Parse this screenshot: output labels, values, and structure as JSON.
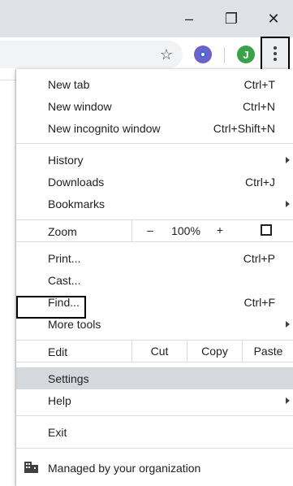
{
  "window": {
    "minimize_glyph": "–",
    "restore_glyph": "❐",
    "close_glyph": "✕"
  },
  "toolbar": {
    "star_glyph": "☆",
    "avatar_letter": "J",
    "accent_color": "#6a62c8",
    "avatar_color": "#3aa34a"
  },
  "menu": {
    "new_tab": {
      "label": "New tab",
      "shortcut": "Ctrl+T"
    },
    "new_window": {
      "label": "New window",
      "shortcut": "Ctrl+N"
    },
    "new_incognito": {
      "label": "New incognito window",
      "shortcut": "Ctrl+Shift+N"
    },
    "history": {
      "label": "History"
    },
    "downloads": {
      "label": "Downloads",
      "shortcut": "Ctrl+J"
    },
    "bookmarks": {
      "label": "Bookmarks"
    },
    "zoom": {
      "label": "Zoom",
      "minus": "–",
      "value": "100%",
      "plus": "+"
    },
    "print": {
      "label": "Print...",
      "shortcut": "Ctrl+P"
    },
    "cast": {
      "label": "Cast..."
    },
    "find": {
      "label": "Find...",
      "shortcut": "Ctrl+F"
    },
    "more_tools": {
      "label": "More tools"
    },
    "edit": {
      "label": "Edit",
      "cut": "Cut",
      "copy": "Copy",
      "paste": "Paste"
    },
    "settings": {
      "label": "Settings",
      "highlight_color": "#d5d8dc"
    },
    "help": {
      "label": "Help"
    },
    "exit": {
      "label": "Exit"
    },
    "managed": {
      "label": "Managed by your organization"
    }
  }
}
